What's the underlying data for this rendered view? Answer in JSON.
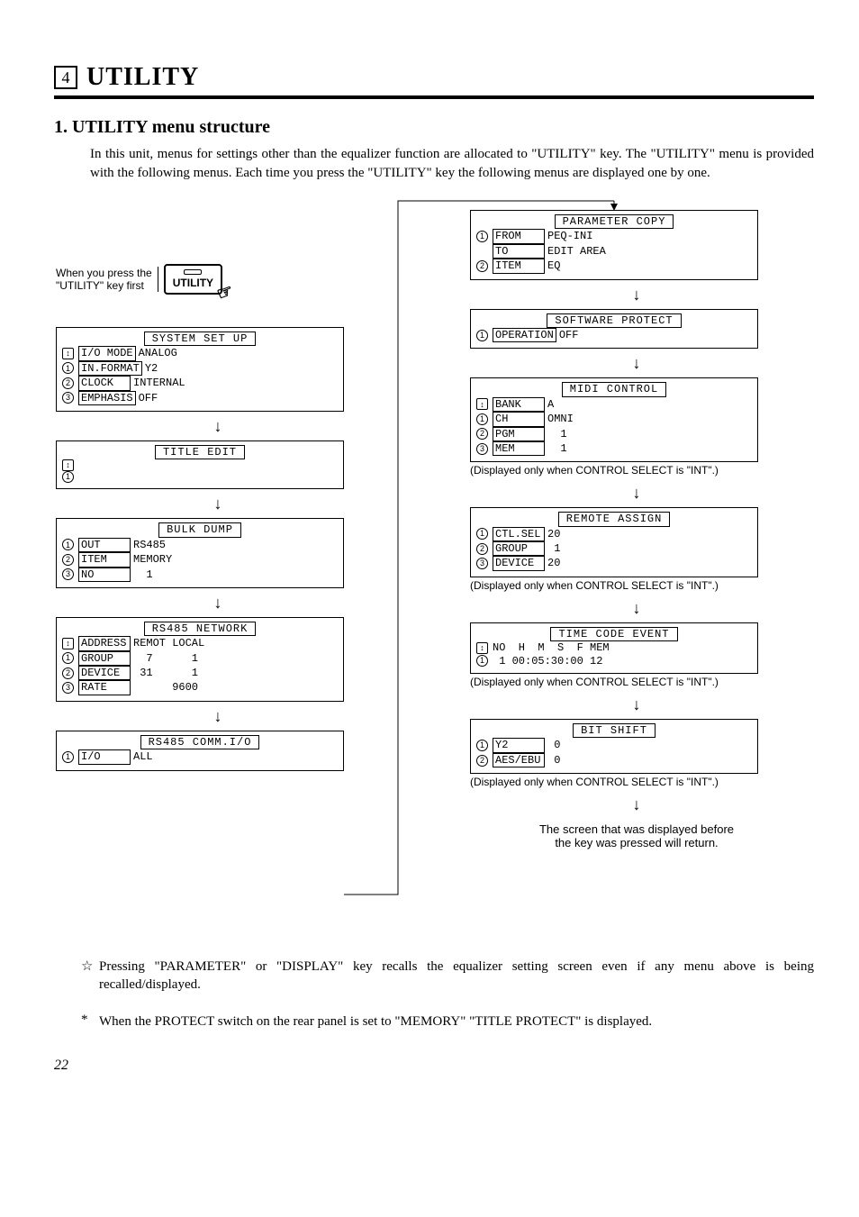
{
  "header": {
    "num": "4",
    "title": "UTILITY"
  },
  "section": {
    "title": "1. UTILITY menu structure",
    "intro": "In this unit, menus for settings other than the equalizer function are allocated to \"UTILITY\" key. The \"UTILITY\" menu is provided with the following menus. Each time you press the \"UTILITY\" key the following menus are displayed one by one."
  },
  "key": {
    "label": "When you press the\n\"UTILITY\" key first",
    "button": "UTILITY"
  },
  "screens_left": [
    {
      "title": "SYSTEM SET UP",
      "rows": [
        {
          "n": "↕",
          "f": "I/O MODE",
          "v": "ANALOG"
        },
        {
          "n": "①",
          "f": "IN.FORMAT",
          "v": "Y2"
        },
        {
          "n": "②",
          "f": "CLOCK",
          "v": "INTERNAL"
        },
        {
          "n": "③",
          "f": "EMPHASIS",
          "v": "OFF"
        }
      ]
    },
    {
      "title": "TITLE EDIT",
      "rows": [
        {
          "n": "↕",
          "f": "",
          "v": ""
        },
        {
          "n": "①",
          "f": "",
          "v": ""
        }
      ]
    },
    {
      "title": "BULK DUMP",
      "rows": [
        {
          "n": "①",
          "f": "OUT",
          "v": "RS485"
        },
        {
          "n": "②",
          "f": "ITEM",
          "v": "MEMORY"
        },
        {
          "n": "③",
          "f": "NO",
          "v": "  1"
        }
      ]
    },
    {
      "title": "RS485 NETWORK",
      "rows": [
        {
          "n": "↕",
          "f": "ADDRESS",
          "v": "REMOT LOCAL"
        },
        {
          "n": "①",
          "f": "GROUP",
          "v": "  7      1"
        },
        {
          "n": "②",
          "f": "DEVICE",
          "v": " 31      1"
        },
        {
          "n": "③",
          "f": "RATE",
          "v": "      9600"
        }
      ]
    },
    {
      "title": "RS485 COMM.I/O",
      "rows": [
        {
          "n": "①",
          "f": "I/O",
          "v": "ALL"
        }
      ]
    }
  ],
  "screens_right": [
    {
      "title": "PARAMETER COPY",
      "rows": [
        {
          "n": "①",
          "f": "FROM",
          "v": "PEQ-INI"
        },
        {
          "n": "",
          "f": "TO",
          "v": "EDIT AREA"
        },
        {
          "n": "②",
          "f": "ITEM",
          "v": "EQ"
        }
      ],
      "note": ""
    },
    {
      "title": "SOFTWARE PROTECT",
      "rows": [
        {
          "n": "①",
          "f": "OPERATION",
          "v": "OFF"
        }
      ],
      "note": ""
    },
    {
      "title": "MIDI CONTROL",
      "rows": [
        {
          "n": "↕",
          "f": "BANK",
          "v": "A"
        },
        {
          "n": "①",
          "f": "CH",
          "v": "OMNI"
        },
        {
          "n": "②",
          "f": "PGM",
          "v": "  1"
        },
        {
          "n": "③",
          "f": "MEM",
          "v": "  1"
        }
      ],
      "note": "(Displayed only when CONTROL SELECT is \"INT\".)"
    },
    {
      "title": "REMOTE ASSIGN",
      "rows": [
        {
          "n": "①",
          "f": "CTL.SEL",
          "v": "20"
        },
        {
          "n": "②",
          "f": "GROUP",
          "v": " 1"
        },
        {
          "n": "③",
          "f": "DEVICE",
          "v": "20"
        }
      ],
      "note": "(Displayed only when CONTROL SELECT is \"INT\".)"
    },
    {
      "title": "TIME CODE EVENT",
      "rows": [
        {
          "n": "↕",
          "f": "",
          "v": "NO  H  M  S  F MEM"
        },
        {
          "n": "①",
          "f": "",
          "v": " 1 00:05:30:00 12"
        }
      ],
      "note": "(Displayed only when CONTROL SELECT is \"INT\".)"
    },
    {
      "title": "BIT SHIFT",
      "rows": [
        {
          "n": "①",
          "f": "Y2",
          "v": " 0"
        },
        {
          "n": "②",
          "f": "AES/EBU",
          "v": " 0"
        }
      ],
      "note": "(Displayed only when CONTROL SELECT is \"INT\".)"
    }
  ],
  "return_text": "The screen that was displayed before\nthe key was pressed will return.",
  "footnotes": [
    {
      "mark": "☆",
      "text": "Pressing \"PARAMETER\" or \"DISPLAY\" key recalls the equalizer setting screen even if any menu above is being recalled/displayed."
    },
    {
      "mark": "*",
      "text": "When the PROTECT switch on the rear panel is set to \"MEMORY\" \"TITLE PROTECT\" is displayed."
    }
  ],
  "page_number": "22"
}
